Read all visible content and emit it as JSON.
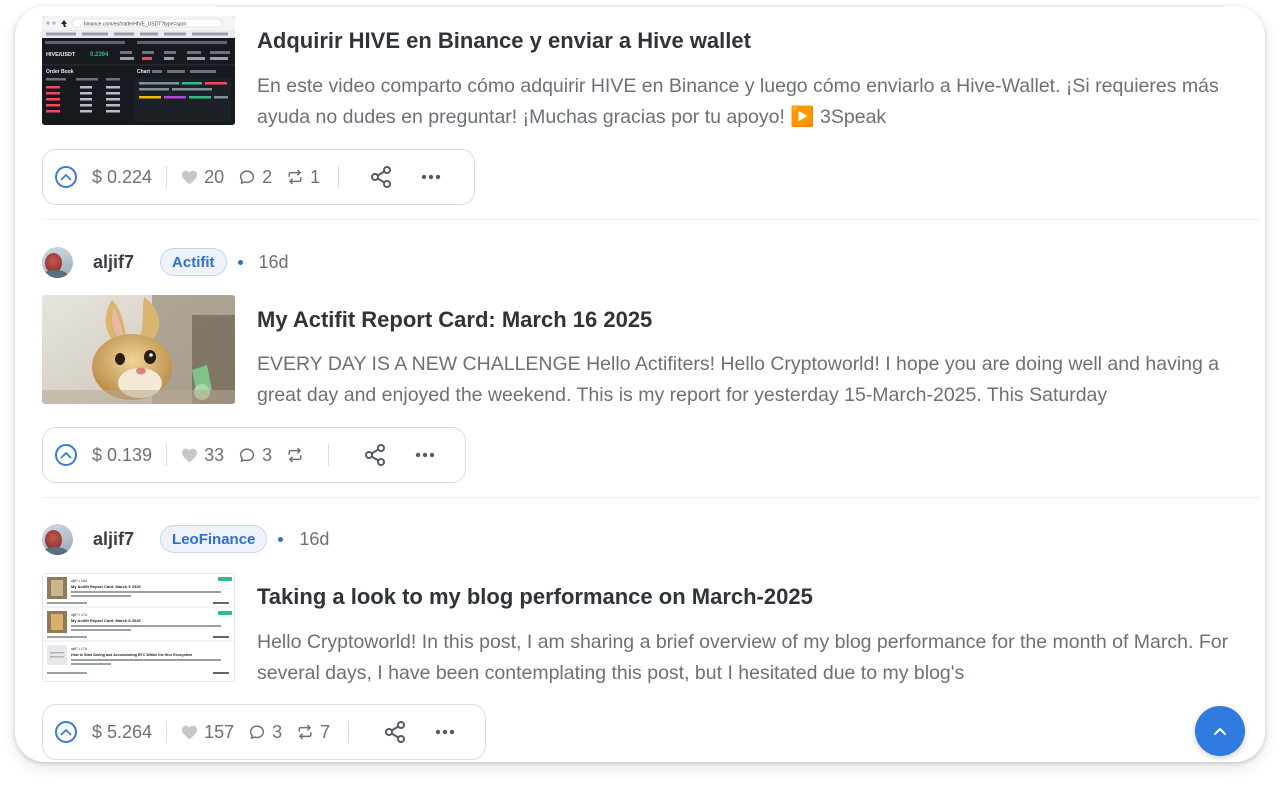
{
  "posts": [
    {
      "title": "Adquirir HIVE en Binance y enviar a Hive wallet",
      "excerpt": "En este video comparto cómo adquirir HIVE en Binance y luego cómo enviarlo a Hive-Wallet. ¡Si requieres más ayuda no dudes en preguntar! ¡Muchas gracias por tu apoyo! ▶️ 3Speak",
      "payout": "$ 0.224",
      "votes": "20",
      "comments": "2",
      "reblogs": "1",
      "thumb_text": {
        "url": "binance.com/es/trade/HIVE_USDT?type=spot",
        "pair": "HIVE/USDT",
        "price": "0.2394",
        "order_book": "Order Book",
        "chart": "Chart"
      }
    },
    {
      "author": "aljif7",
      "community": "Actifit",
      "age": "16d",
      "title": "My Actifit Report Card: March 16 2025",
      "excerpt": "EVERY DAY IS A NEW CHALLENGE Hello Actifiters! Hello Cryptoworld! I hope you are doing well and having a great day and enjoyed the weekend. This is my report for yesterday 15-March-2025. This Saturday",
      "payout": "$ 0.139",
      "votes": "33",
      "comments": "3",
      "reblogs": ""
    },
    {
      "author": "aljif7",
      "community": "LeoFinance",
      "age": "16d",
      "title": "Taking a look to my blog performance on March-2025",
      "excerpt": "Hello Cryptoworld! In this post, I am sharing a brief overview of my blog performance for the month of March. For several days, I have been contemplating this post, but I hesitated due to my blog's",
      "payout": "$ 5.264",
      "votes": "157",
      "comments": "3",
      "reblogs": "7",
      "thumb_text": {
        "t1": "My Actifit Report Card: March 9 2025",
        "t2": "My Actifit Report Card: March 8 2025",
        "t3": "How to Start Saving and Accumulating BTC Within the Hive Ecosystem"
      }
    }
  ],
  "icons": {
    "upvote": "chevron-up-circle-icon",
    "heart": "heart-icon",
    "comment": "comment-icon",
    "reblog": "reblog-icon",
    "share": "share-icon",
    "more": "more-icon",
    "scroll_top": "chevron-up-icon"
  },
  "colors": {
    "accent": "#2f6fd1",
    "fab": "#2f7be0",
    "muted": "#6b7178"
  }
}
